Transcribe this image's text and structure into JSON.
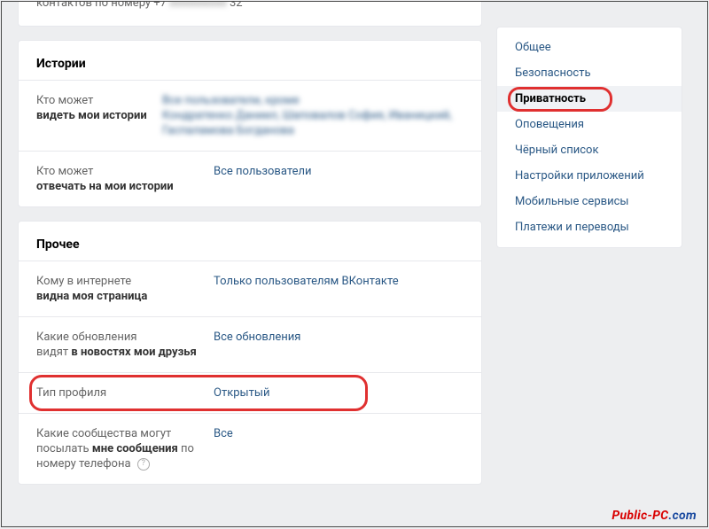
{
  "topFragment": {
    "prefix": "контактов по номеру +7",
    "blurred": "xxxxxxxxxx",
    "suffix": "32"
  },
  "sections": {
    "stories": {
      "title": "Истории",
      "rows": [
        {
          "labelLine1": "Кто может",
          "labelBold": "видеть мои истории",
          "value": "Все пользователи, кроме",
          "blurredNames": "Кондратенко Даниил, Шаповалов София, Иваницкий, Гаспаламова Богданова",
          "isBlurred": true
        },
        {
          "labelLine1": "Кто может",
          "labelBold": "отвечать на мои истории",
          "value": "Все пользователи",
          "isBlurred": false
        }
      ]
    },
    "other": {
      "title": "Прочее",
      "rows": [
        {
          "labelLine1": "Кому в интернете",
          "labelBold": "видна моя страница",
          "value": "Только пользователям ВКонтакте"
        },
        {
          "labelLine1": "Какие обновления",
          "labelLine2a": "видят ",
          "labelBold": "в новостях мои друзья",
          "value": "Все обновления"
        },
        {
          "labelLine1": "Тип профиля",
          "value": "Открытый",
          "highlighted": true
        },
        {
          "labelLine1": "Какие сообщества могут",
          "labelLine2a": "посылать ",
          "labelBold": "мне сообщения",
          "labelLine2b": " по номеру телефона",
          "hasHelp": true,
          "value": "Все"
        }
      ]
    }
  },
  "sidebar": {
    "items": [
      {
        "label": "Общее",
        "active": false
      },
      {
        "label": "Безопасность",
        "active": false
      },
      {
        "label": "Приватность",
        "active": true
      },
      {
        "label": "Оповещения",
        "active": false
      },
      {
        "label": "Чёрный список",
        "active": false
      },
      {
        "label": "Настройки приложений",
        "active": false
      },
      {
        "label": "Мобильные сервисы",
        "active": false
      },
      {
        "label": "Платежи и переводы",
        "active": false
      }
    ]
  },
  "watermark": {
    "p1": "Public-PC",
    "p2": ".com"
  }
}
